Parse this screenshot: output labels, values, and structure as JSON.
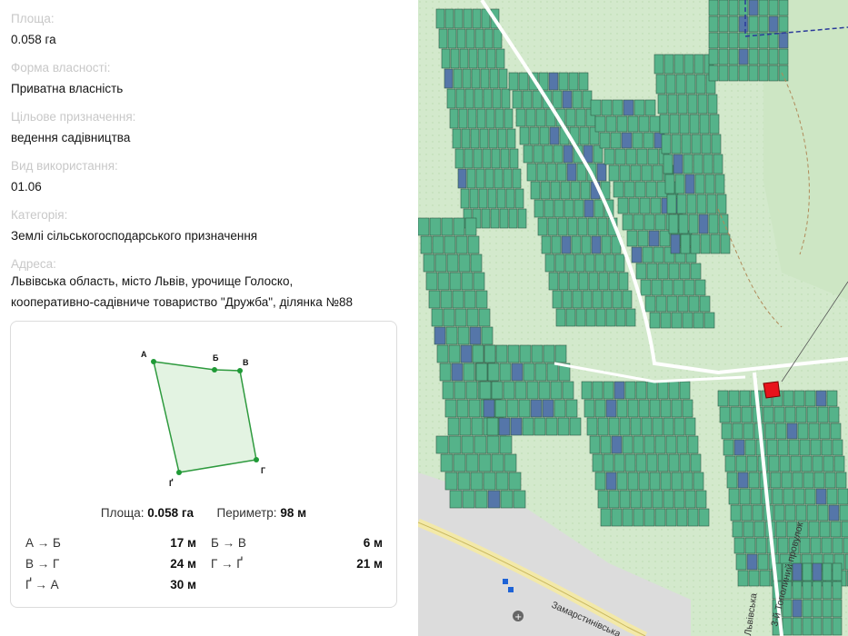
{
  "fields": [
    {
      "label": "Площа:",
      "value": "0.058 га"
    },
    {
      "label": "Форма власності:",
      "value": "Приватна власність"
    },
    {
      "label": "Цільове призначення:",
      "value": "ведення садівництва"
    },
    {
      "label": "Вид використання:",
      "value": "01.06"
    },
    {
      "label": "Категорія:",
      "value": "Землі сільськогосподарського призначення"
    },
    {
      "label": "Адреса:",
      "value_line1": "Львівська область, місто Львів, урочище Голоско,",
      "value_line2": "кооперативно-садівниче товариство \"Дружба\", ділянка №88"
    }
  ],
  "plot": {
    "vertices": [
      "А",
      "Б",
      "В",
      "Г",
      "Ґ"
    ],
    "area_label": "Площа:",
    "area_value": "0.058 га",
    "perimeter_label": "Периметр:",
    "perimeter_value": "98 м",
    "edges": [
      {
        "name": "А → Б",
        "length": "17 м"
      },
      {
        "name": "Б → В",
        "length": "6 м"
      },
      {
        "name": "В → Г",
        "length": "24 м"
      },
      {
        "name": "Г → Ґ",
        "length": "21 м"
      },
      {
        "name": "Ґ → А",
        "length": "30 м"
      }
    ],
    "fill_color": "#e3f3e2",
    "stroke_color": "#2e9a3e"
  },
  "map": {
    "street_label_1": "Замарстинівська",
    "street_label_2": "3-й Тополиний провулок",
    "street_label_3": "Львівська",
    "selected_parcel_color": "#e8131b",
    "parcel_color": "#55b38a",
    "parcel_color_alt": "#5576a9",
    "background_color": "#d3e9cc"
  }
}
